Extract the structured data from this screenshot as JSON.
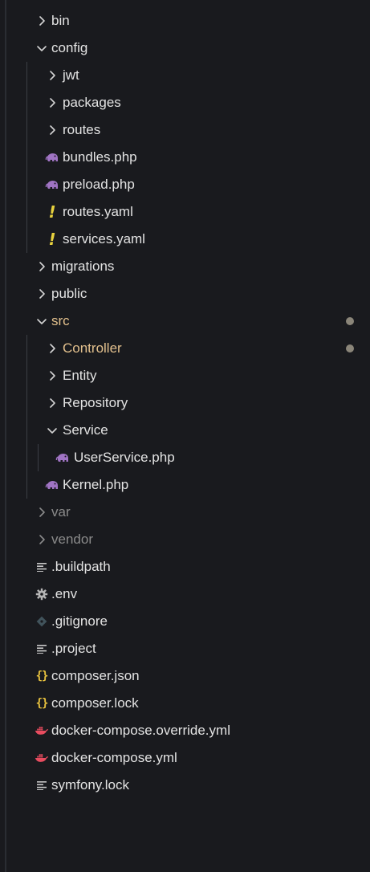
{
  "colors": {
    "background": "#191a1e",
    "text": "#e3e3e3",
    "dimmed_text": "#8b8b8b",
    "modified_text": "#e2c08d",
    "php_icon": "#a074c4",
    "yaml_icon": "#e8d23e",
    "json_icon": "#e8c23e",
    "docker_icon": "#e84c5f",
    "gitignore_icon": "#41535b",
    "modified_dot": "#8a8579"
  },
  "tree": [
    {
      "label": "bin",
      "kind": "folder",
      "expanded": false,
      "depth": 0
    },
    {
      "label": "config",
      "kind": "folder",
      "expanded": true,
      "depth": 0
    },
    {
      "label": "jwt",
      "kind": "folder",
      "expanded": false,
      "depth": 1
    },
    {
      "label": "packages",
      "kind": "folder",
      "expanded": false,
      "depth": 1
    },
    {
      "label": "routes",
      "kind": "folder",
      "expanded": false,
      "depth": 1
    },
    {
      "label": "bundles.php",
      "kind": "file",
      "icon": "php-elephant-icon",
      "depth": 1
    },
    {
      "label": "preload.php",
      "kind": "file",
      "icon": "php-elephant-icon",
      "depth": 1
    },
    {
      "label": "routes.yaml",
      "kind": "file",
      "icon": "yaml-icon",
      "depth": 1
    },
    {
      "label": "services.yaml",
      "kind": "file",
      "icon": "yaml-icon",
      "depth": 1
    },
    {
      "label": "migrations",
      "kind": "folder",
      "expanded": false,
      "depth": 0
    },
    {
      "label": "public",
      "kind": "folder",
      "expanded": false,
      "depth": 0
    },
    {
      "label": "src",
      "kind": "folder",
      "expanded": true,
      "depth": 0,
      "modified": true
    },
    {
      "label": "Controller",
      "kind": "folder",
      "expanded": false,
      "depth": 1,
      "modified": true
    },
    {
      "label": "Entity",
      "kind": "folder",
      "expanded": false,
      "depth": 1
    },
    {
      "label": "Repository",
      "kind": "folder",
      "expanded": false,
      "depth": 1
    },
    {
      "label": "Service",
      "kind": "folder",
      "expanded": true,
      "depth": 1
    },
    {
      "label": "UserService.php",
      "kind": "file",
      "icon": "php-elephant-icon",
      "depth": 2
    },
    {
      "label": "Kernel.php",
      "kind": "file",
      "icon": "php-elephant-icon",
      "depth": 1
    },
    {
      "label": "var",
      "kind": "folder",
      "expanded": false,
      "depth": 0,
      "dimmed": true
    },
    {
      "label": "vendor",
      "kind": "folder",
      "expanded": false,
      "depth": 0,
      "dimmed": true
    },
    {
      "label": ".buildpath",
      "kind": "file",
      "icon": "lines-icon",
      "depth": 0
    },
    {
      "label": ".env",
      "kind": "file",
      "icon": "gear-icon",
      "depth": 0
    },
    {
      "label": ".gitignore",
      "kind": "file",
      "icon": "git-diamond-icon",
      "depth": 0
    },
    {
      "label": ".project",
      "kind": "file",
      "icon": "lines-icon",
      "depth": 0
    },
    {
      "label": "composer.json",
      "kind": "file",
      "icon": "json-braces-icon",
      "depth": 0
    },
    {
      "label": "composer.lock",
      "kind": "file",
      "icon": "json-braces-icon",
      "depth": 0
    },
    {
      "label": "docker-compose.override.yml",
      "kind": "file",
      "icon": "docker-whale-icon",
      "depth": 0
    },
    {
      "label": "docker-compose.yml",
      "kind": "file",
      "icon": "docker-whale-icon",
      "depth": 0
    },
    {
      "label": "symfony.lock",
      "kind": "file",
      "icon": "lines-icon",
      "depth": 0
    }
  ]
}
